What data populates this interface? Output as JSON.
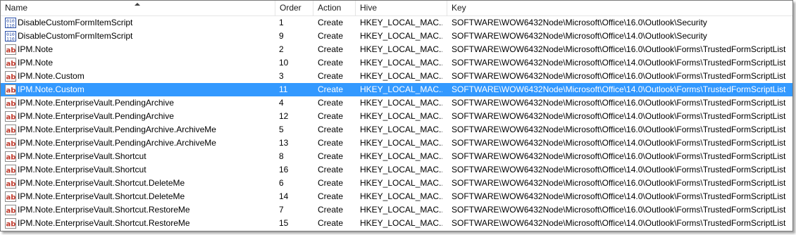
{
  "columns": {
    "name": "Name",
    "order": "Order",
    "action": "Action",
    "hive": "Hive",
    "key": "Key"
  },
  "rows": [
    {
      "name": "DisableCustomFormItemScript",
      "order": "1",
      "action": "Create",
      "hive": "HKEY_LOCAL_MAC...",
      "key": "SOFTWARE\\WOW6432Node\\Microsoft\\Office\\16.0\\Outlook\\Security",
      "icon": "registry-binary-icon",
      "selected": false
    },
    {
      "name": "DisableCustomFormItemScript",
      "order": "9",
      "action": "Create",
      "hive": "HKEY_LOCAL_MAC...",
      "key": "SOFTWARE\\WOW6432Node\\Microsoft\\Office\\14.0\\Outlook\\Security",
      "icon": "registry-binary-icon",
      "selected": false
    },
    {
      "name": "IPM.Note",
      "order": "2",
      "action": "Create",
      "hive": "HKEY_LOCAL_MAC...",
      "key": "SOFTWARE\\WOW6432Node\\Microsoft\\Office\\16.0\\Outlook\\Forms\\TrustedFormScriptList",
      "icon": "registry-string-icon",
      "selected": false
    },
    {
      "name": "IPM.Note",
      "order": "10",
      "action": "Create",
      "hive": "HKEY_LOCAL_MAC...",
      "key": "SOFTWARE\\WOW6432Node\\Microsoft\\Office\\14.0\\Outlook\\Forms\\TrustedFormScriptList",
      "icon": "registry-string-icon",
      "selected": false
    },
    {
      "name": "IPM.Note.Custom",
      "order": "3",
      "action": "Create",
      "hive": "HKEY_LOCAL_MAC...",
      "key": "SOFTWARE\\WOW6432Node\\Microsoft\\Office\\16.0\\Outlook\\Forms\\TrustedFormScriptList",
      "icon": "registry-string-icon",
      "selected": false
    },
    {
      "name": "IPM.Note.Custom",
      "order": "11",
      "action": "Create",
      "hive": "HKEY_LOCAL_MAC...",
      "key": "SOFTWARE\\WOW6432Node\\Microsoft\\Office\\14.0\\Outlook\\Forms\\TrustedFormScriptList",
      "icon": "registry-string-icon",
      "selected": true
    },
    {
      "name": "IPM.Note.EnterpriseVault.PendingArchive",
      "order": "4",
      "action": "Create",
      "hive": "HKEY_LOCAL_MAC...",
      "key": "SOFTWARE\\WOW6432Node\\Microsoft\\Office\\16.0\\Outlook\\Forms\\TrustedFormScriptList",
      "icon": "registry-string-icon",
      "selected": false
    },
    {
      "name": "IPM.Note.EnterpriseVault.PendingArchive",
      "order": "12",
      "action": "Create",
      "hive": "HKEY_LOCAL_MAC...",
      "key": "SOFTWARE\\WOW6432Node\\Microsoft\\Office\\14.0\\Outlook\\Forms\\TrustedFormScriptList",
      "icon": "registry-string-icon",
      "selected": false
    },
    {
      "name": "IPM.Note.EnterpriseVault.PendingArchive.ArchiveMe",
      "order": "5",
      "action": "Create",
      "hive": "HKEY_LOCAL_MAC...",
      "key": "SOFTWARE\\WOW6432Node\\Microsoft\\Office\\16.0\\Outlook\\Forms\\TrustedFormScriptList",
      "icon": "registry-string-icon",
      "selected": false
    },
    {
      "name": "IPM.Note.EnterpriseVault.PendingArchive.ArchiveMe",
      "order": "13",
      "action": "Create",
      "hive": "HKEY_LOCAL_MAC...",
      "key": "SOFTWARE\\WOW6432Node\\Microsoft\\Office\\14.0\\Outlook\\Forms\\TrustedFormScriptList",
      "icon": "registry-string-icon",
      "selected": false
    },
    {
      "name": "IPM.Note.EnterpriseVault.Shortcut",
      "order": "8",
      "action": "Create",
      "hive": "HKEY_LOCAL_MAC...",
      "key": "SOFTWARE\\WOW6432Node\\Microsoft\\Office\\16.0\\Outlook\\Forms\\TrustedFormScriptList",
      "icon": "registry-string-icon",
      "selected": false
    },
    {
      "name": "IPM.Note.EnterpriseVault.Shortcut",
      "order": "16",
      "action": "Create",
      "hive": "HKEY_LOCAL_MAC...",
      "key": "SOFTWARE\\WOW6432Node\\Microsoft\\Office\\14.0\\Outlook\\Forms\\TrustedFormScriptList",
      "icon": "registry-string-icon",
      "selected": false
    },
    {
      "name": "IPM.Note.EnterpriseVault.Shortcut.DeleteMe",
      "order": "6",
      "action": "Create",
      "hive": "HKEY_LOCAL_MAC...",
      "key": "SOFTWARE\\WOW6432Node\\Microsoft\\Office\\16.0\\Outlook\\Forms\\TrustedFormScriptList",
      "icon": "registry-string-icon",
      "selected": false
    },
    {
      "name": "IPM.Note.EnterpriseVault.Shortcut.DeleteMe",
      "order": "14",
      "action": "Create",
      "hive": "HKEY_LOCAL_MAC...",
      "key": "SOFTWARE\\WOW6432Node\\Microsoft\\Office\\14.0\\Outlook\\Forms\\TrustedFormScriptList",
      "icon": "registry-string-icon",
      "selected": false
    },
    {
      "name": "IPM.Note.EnterpriseVault.Shortcut.RestoreMe",
      "order": "7",
      "action": "Create",
      "hive": "HKEY_LOCAL_MAC...",
      "key": "SOFTWARE\\WOW6432Node\\Microsoft\\Office\\16.0\\Outlook\\Forms\\TrustedFormScriptList",
      "icon": "registry-string-icon",
      "selected": false
    },
    {
      "name": "IPM.Note.EnterpriseVault.Shortcut.RestoreMe",
      "order": "15",
      "action": "Create",
      "hive": "HKEY_LOCAL_MAC...",
      "key": "SOFTWARE\\WOW6432Node\\Microsoft\\Office\\14.0\\Outlook\\Forms\\TrustedFormScriptList",
      "icon": "registry-string-icon",
      "selected": false
    }
  ],
  "colors": {
    "selection": "#3399ff",
    "grid_line": "#e5e5e5",
    "border": "#7a7a7a"
  }
}
